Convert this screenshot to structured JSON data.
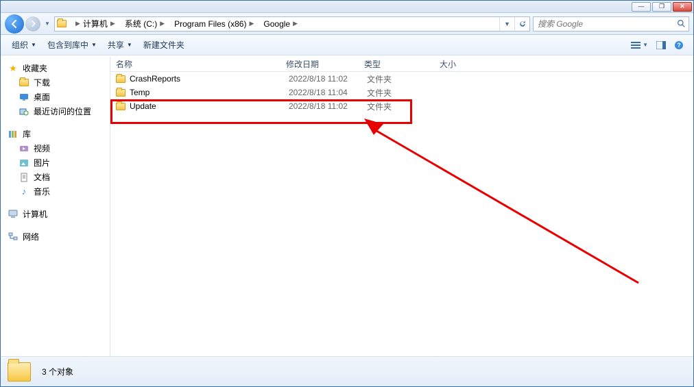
{
  "window_buttons": {
    "min": "—",
    "max": "❐",
    "close": "✕"
  },
  "breadcrumb": [
    "计算机",
    "系统 (C:)",
    "Program Files (x86)",
    "Google"
  ],
  "search": {
    "placeholder": "搜索 Google"
  },
  "toolbar": {
    "organize": "组织",
    "include": "包含到库中",
    "share": "共享",
    "new_folder": "新建文件夹"
  },
  "columns": {
    "name": "名称",
    "date": "修改日期",
    "type": "类型",
    "size": "大小"
  },
  "rows": [
    {
      "name": "CrashReports",
      "date": "2022/8/18 11:02",
      "type": "文件夹"
    },
    {
      "name": "Temp",
      "date": "2022/8/18 11:04",
      "type": "文件夹"
    },
    {
      "name": "Update",
      "date": "2022/8/18 11:02",
      "type": "文件夹"
    }
  ],
  "sidebar": {
    "favorites": {
      "label": "收藏夹",
      "items": [
        "下载",
        "桌面",
        "最近访问的位置"
      ]
    },
    "libraries": {
      "label": "库",
      "items": [
        "视频",
        "图片",
        "文档",
        "音乐"
      ]
    },
    "computer": {
      "label": "计算机"
    },
    "network": {
      "label": "网络"
    }
  },
  "status": {
    "count_text": "3 个对象"
  },
  "annotation": {
    "highlight_row_index": 2,
    "colors": {
      "highlight": "#e60000"
    }
  }
}
